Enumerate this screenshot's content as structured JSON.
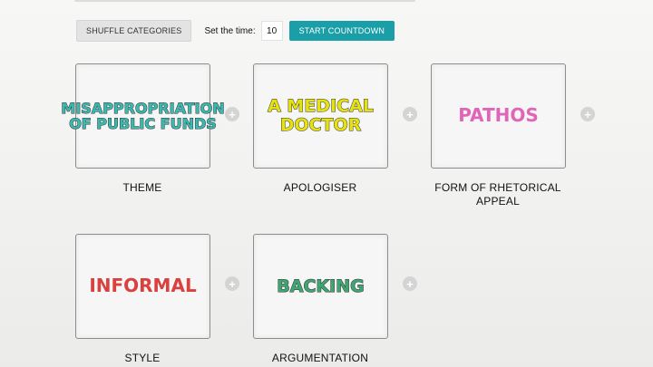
{
  "controls": {
    "shuffle_label": "SHUFFLE CATEGORIES",
    "time_label": "Set the time:",
    "time_value": "10",
    "start_label": "START COUNTDOWN"
  },
  "cards": [
    {
      "word": "MISAPPROPRIATION OF PUBLIC FUNDS",
      "category": "THEME",
      "color": "#3bb9b0"
    },
    {
      "word": "A MEDICAL DOCTOR",
      "category": "APOLOGISER",
      "color": "#e6e20f"
    },
    {
      "word": "PATHOS",
      "category": "FORM OF RHETORICAL APPEAL",
      "color": "#e264b8"
    },
    {
      "word": "INFORMAL",
      "category": "STYLE",
      "color": "#d9403e"
    },
    {
      "word": "BACKING",
      "category": "ARGUMENTATION",
      "color": "#3fa572"
    }
  ],
  "add_icon": "plus-circle-icon",
  "accent_color": "#1a9fa9"
}
